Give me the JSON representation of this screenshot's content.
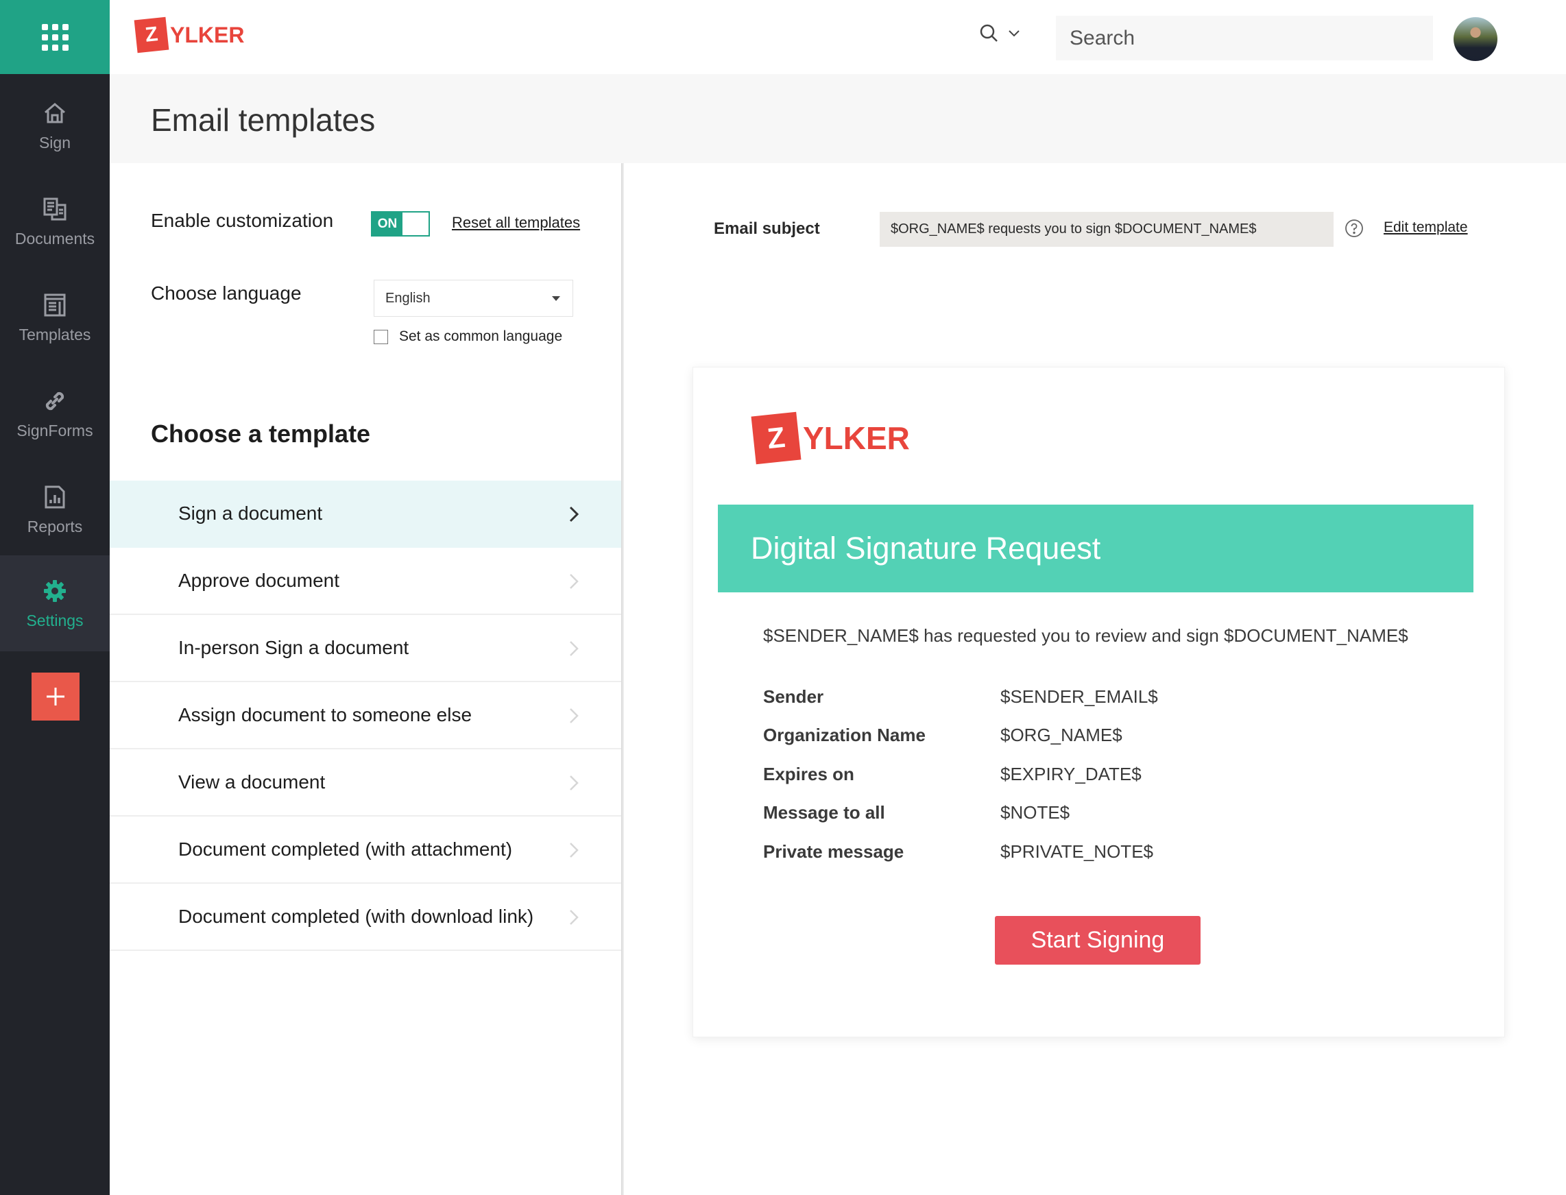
{
  "app": {
    "brand": {
      "mark": "Z",
      "name": "YLKER",
      "color": "#e8453c"
    },
    "accent_color": "#20a386"
  },
  "sidebar": {
    "apps_icon": "grid-icon",
    "items": [
      {
        "label": "Sign",
        "icon": "home-icon",
        "active": false
      },
      {
        "label": "Documents",
        "icon": "documents-icon",
        "active": false
      },
      {
        "label": "Templates",
        "icon": "templates-icon",
        "active": false
      },
      {
        "label": "SignForms",
        "icon": "link-icon",
        "active": false
      },
      {
        "label": "Reports",
        "icon": "reports-icon",
        "active": false
      },
      {
        "label": "Settings",
        "icon": "gear-icon",
        "active": true
      }
    ],
    "add_icon": "plus-icon"
  },
  "header": {
    "search_icon": "search-icon",
    "search_dropdown_icon": "chevron-down-icon",
    "search_placeholder": "Search"
  },
  "page": {
    "title": "Email templates"
  },
  "settings_panel": {
    "enable_label": "Enable customization",
    "toggle_state": "ON",
    "reset_link": "Reset all templates",
    "language_label": "Choose language",
    "language_value": "English",
    "common_language_label": "Set as common language",
    "common_language_checked": false,
    "choose_template_title": "Choose a template",
    "templates": [
      {
        "label": "Sign a document",
        "active": true
      },
      {
        "label": "Approve document",
        "active": false
      },
      {
        "label": "In-person Sign a document",
        "active": false
      },
      {
        "label": "Assign document to someone else",
        "active": false
      },
      {
        "label": "View a document",
        "active": false
      },
      {
        "label": "Document completed (with attachment)",
        "active": false
      },
      {
        "label": "Document completed (with download link)",
        "active": false
      }
    ]
  },
  "preview": {
    "subject_label": "Email subject",
    "subject_value": "$ORG_NAME$ requests you to sign $DOCUMENT_NAME$",
    "help_icon": "help-circle-icon",
    "edit_link": "Edit template",
    "email": {
      "logo_mark": "Z",
      "logo_name": "YLKER",
      "banner_title": "Digital Signature Request",
      "banner_color": "#53d1b5",
      "intro": "$SENDER_NAME$ has requested you to review and sign $DOCUMENT_NAME$",
      "details": [
        {
          "key": "Sender",
          "value": "$SENDER_EMAIL$"
        },
        {
          "key": "Organization Name",
          "value": "$ORG_NAME$"
        },
        {
          "key": "Expires on",
          "value": "$EXPIRY_DATE$"
        },
        {
          "key": "Message to all",
          "value": "$NOTE$"
        },
        {
          "key": "Private message",
          "value": "$PRIVATE_NOTE$"
        }
      ],
      "cta_label": "Start Signing",
      "cta_color": "#e8505b"
    }
  }
}
